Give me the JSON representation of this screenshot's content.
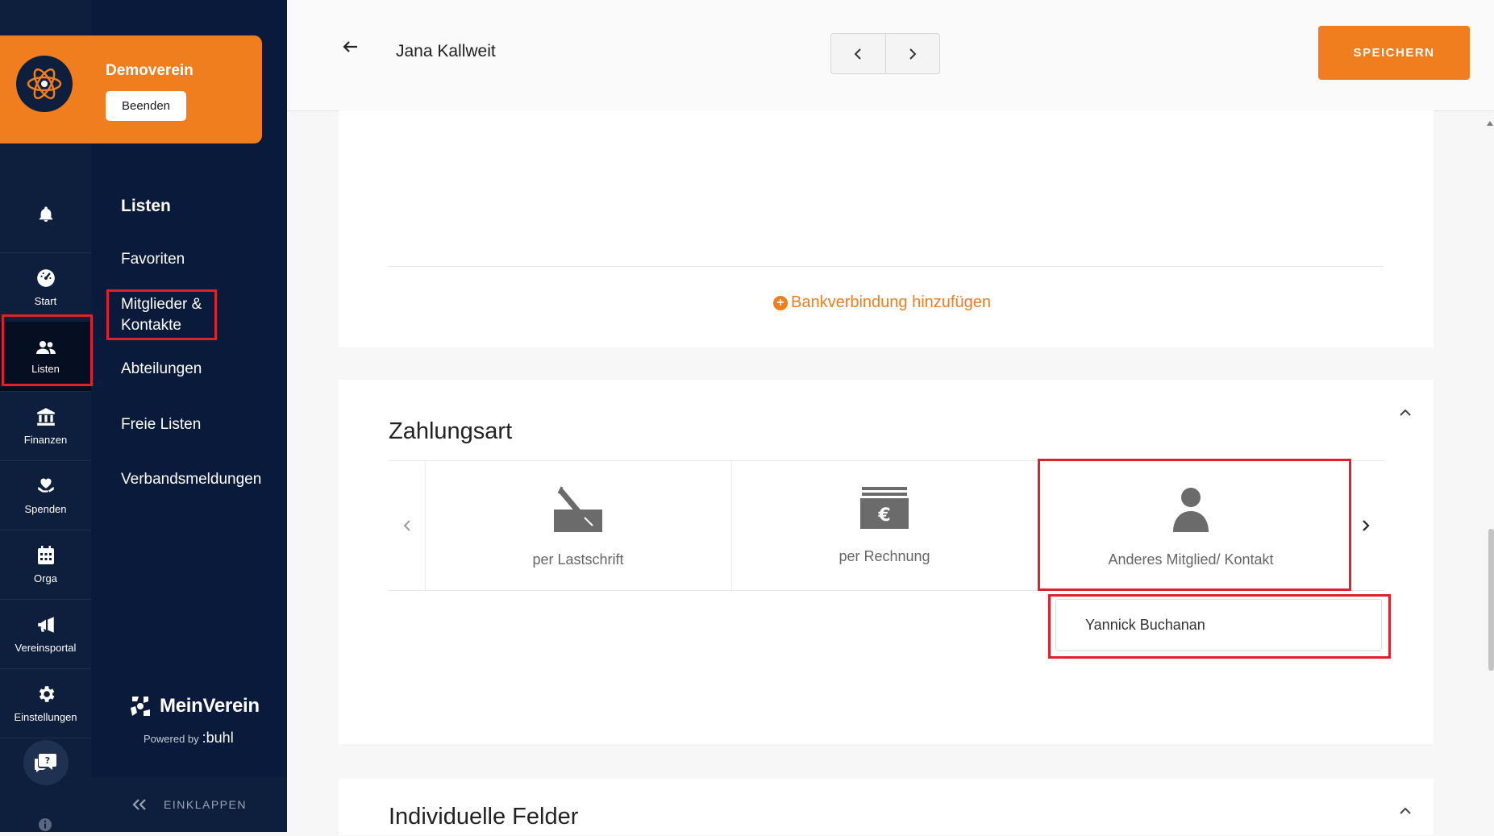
{
  "org": {
    "name": "Demoverein",
    "end_button": "Beenden"
  },
  "rail": [
    {
      "key": "notifications",
      "label": "",
      "icon": "bell-icon"
    },
    {
      "key": "start",
      "label": "Start",
      "icon": "dashboard-icon"
    },
    {
      "key": "listen",
      "label": "Listen",
      "icon": "users-icon",
      "active": true
    },
    {
      "key": "finanzen",
      "label": "Finanzen",
      "icon": "bank-icon"
    },
    {
      "key": "spenden",
      "label": "Spenden",
      "icon": "heart-hand-icon"
    },
    {
      "key": "orga",
      "label": "Orga",
      "icon": "calendar-icon"
    },
    {
      "key": "vereinsportal",
      "label": "Vereinsportal",
      "icon": "megaphone-icon"
    },
    {
      "key": "einstellungen",
      "label": "Einstellungen",
      "icon": "gear-icon"
    }
  ],
  "nav": {
    "heading": "Listen",
    "items": [
      "Favoriten",
      "Mitglieder &",
      "Kontakte",
      "Abteilungen",
      "Freie Listen",
      "Verbandsmeldungen"
    ]
  },
  "brand": {
    "name": "MeinVerein",
    "powered": "Powered by",
    "powered_brand": ":buhl"
  },
  "collapse_label": "EINKLAPPEN",
  "header": {
    "name": "Jana Kallweit",
    "save": "SPEICHERN"
  },
  "bank": {
    "add_label": "Bankverbindung hinzufügen"
  },
  "payment": {
    "title": "Zahlungsart",
    "options": [
      "per Lastschrift",
      "per Rechnung",
      "Anderes Mitglied/ Kontakt"
    ],
    "selected_contact": "Yannick Buchanan"
  },
  "custom_fields": {
    "title": "Individuelle Felder"
  },
  "colors": {
    "accent": "#f07d1e",
    "sidebar": "#0a1a3a",
    "highlight": "#e0202a"
  }
}
